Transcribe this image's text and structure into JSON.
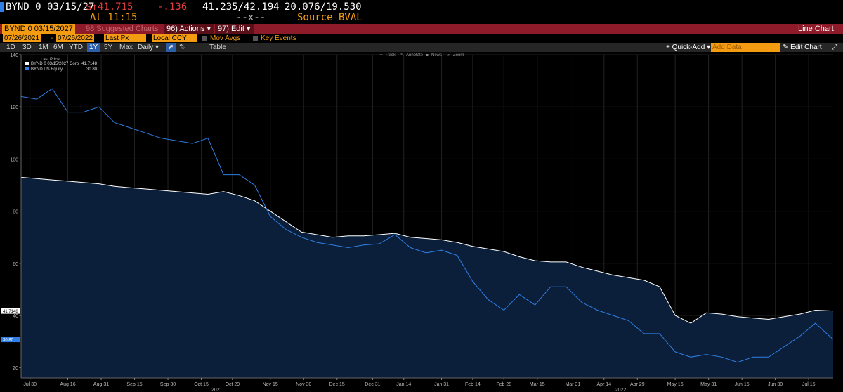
{
  "quote": {
    "ticker": "BYND 0 03/15/27",
    "arrow_price": "$↑41.715",
    "change": "-.136",
    "time": "At 11:15",
    "bid_ask": "41.235/42.194",
    "bid_ask_sub": "--x--",
    "yields": "20.076/19.530",
    "source": "Source BVAL"
  },
  "toolbar": {
    "security": "BYND 0 03/15/2027",
    "suggested": "98 Suggested Charts",
    "actions": "96) Actions ▾",
    "edit": "97) Edit ▾",
    "title": "Line Chart",
    "start_date": "07/26/2021",
    "end_date": "07/26/2022",
    "price_field": "Last Px",
    "currency": "Local CCY",
    "mov_avgs": "Mov Avgs",
    "key_events": "Key Events"
  },
  "periods": [
    "1D",
    "3D",
    "1M",
    "6M",
    "YTD",
    "1Y",
    "5Y",
    "Max"
  ],
  "selected_period": "1Y",
  "frequency": "Daily ▾",
  "table_label": "Table",
  "quick_add": "+ Quick-Add ▾",
  "add_data_placeholder": "Add Data",
  "edit_chart": "✎ Edit Chart",
  "chart_controls": [
    "Track",
    "Annotate",
    "News",
    "Zoom"
  ],
  "colors": {
    "background": "#000000",
    "accent_red": "#8e1b2a",
    "orange": "#f39c12",
    "area_fill": "#0b1f3a",
    "line_white": "#ffffff",
    "line_blue": "#2f7fe6"
  },
  "chart_data": {
    "type": "area",
    "title": "",
    "legend_title": "Last Price",
    "legend": [
      {
        "name": "BYND 0 03/15/2027 Corp",
        "value": "41.7148",
        "color": "#ffffff"
      },
      {
        "name": "BYND US Equity",
        "value": "30.80",
        "color": "#2f7fe6"
      }
    ],
    "ylim": [
      16,
      140
    ],
    "yticks": [
      20,
      40,
      60,
      80,
      100,
      120,
      140
    ],
    "last_value_labels": [
      "41.7148",
      "30.80"
    ],
    "x_tick_labels": [
      "Jul 30",
      "Aug 16",
      "Aug 31",
      "Sep 15",
      "Sep 30",
      "Oct 15",
      "Oct 29",
      "Nov 15",
      "Nov 30",
      "Dec 15",
      "Dec 31",
      "Jan 14",
      "Jan 31",
      "Feb 14",
      "Feb 28",
      "Mar 15",
      "Mar 31",
      "Apr 14",
      "Apr 29",
      "May 16",
      "May 31",
      "Jun 15",
      "Jun 30",
      "Jul 15"
    ],
    "year_labels": [
      {
        "label": "2021",
        "after": "Oct 15"
      },
      {
        "label": "2022",
        "after": "Apr 14"
      }
    ],
    "x": [
      "2021-07-26",
      "2021-08-02",
      "2021-08-09",
      "2021-08-16",
      "2021-08-23",
      "2021-08-30",
      "2021-09-06",
      "2021-09-13",
      "2021-09-20",
      "2021-09-27",
      "2021-10-04",
      "2021-10-11",
      "2021-10-18",
      "2021-10-25",
      "2021-11-01",
      "2021-11-08",
      "2021-11-15",
      "2021-11-22",
      "2021-11-29",
      "2021-12-06",
      "2021-12-13",
      "2021-12-20",
      "2021-12-27",
      "2022-01-03",
      "2022-01-10",
      "2022-01-17",
      "2022-01-24",
      "2022-01-31",
      "2022-02-07",
      "2022-02-14",
      "2022-02-21",
      "2022-02-28",
      "2022-03-07",
      "2022-03-14",
      "2022-03-21",
      "2022-03-28",
      "2022-04-04",
      "2022-04-11",
      "2022-04-18",
      "2022-04-25",
      "2022-05-02",
      "2022-05-09",
      "2022-05-16",
      "2022-05-23",
      "2022-05-30",
      "2022-06-06",
      "2022-06-13",
      "2022-06-20",
      "2022-06-27",
      "2022-07-04",
      "2022-07-11",
      "2022-07-18",
      "2022-07-26"
    ],
    "series": [
      {
        "name": "BYND 0 03/15/2027 Corp",
        "values": [
          93,
          92.5,
          92,
          91.5,
          91,
          90.5,
          89.5,
          89,
          88.5,
          88,
          87.5,
          87,
          86.5,
          87.5,
          86,
          84,
          80,
          76,
          72,
          71,
          70,
          70.5,
          70.5,
          71,
          71.5,
          70,
          69.5,
          69,
          68,
          66.5,
          65.5,
          64.5,
          62.5,
          61,
          60.5,
          60.5,
          58.5,
          57,
          55.5,
          54.5,
          53.5,
          51,
          40,
          37,
          41,
          40.5,
          39.5,
          39,
          38.5,
          39.5,
          40.5,
          42,
          41.7148
        ],
        "color": "#ffffff"
      },
      {
        "name": "BYND US Equity",
        "values": [
          124,
          123,
          127,
          118,
          118,
          120,
          114,
          112,
          110,
          108,
          107,
          106,
          108,
          94,
          94,
          90,
          78,
          73,
          70,
          68,
          67,
          66,
          67,
          67.5,
          71,
          66,
          64,
          65,
          63,
          53,
          46,
          42,
          48,
          44,
          51,
          51,
          45,
          42,
          40,
          38,
          33,
          33,
          26,
          24,
          25,
          24,
          22,
          24,
          24,
          28,
          32,
          37,
          30.8
        ],
        "color": "#2f7fe6"
      }
    ]
  }
}
